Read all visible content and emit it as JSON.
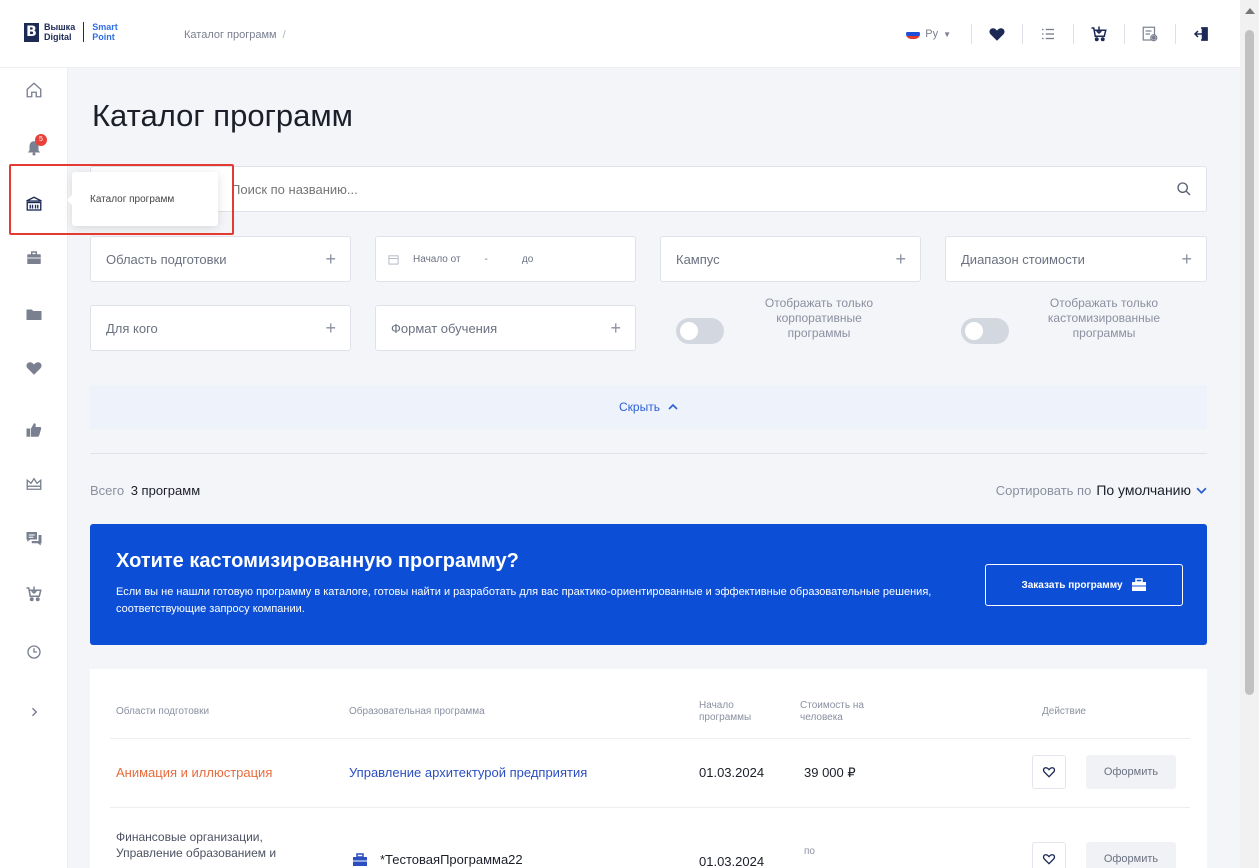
{
  "header": {
    "logo_line1a": "Вышка",
    "logo_line1b": "Digital",
    "logo_line2a": "Smart",
    "logo_line2b": "Point",
    "breadcrumb": "Каталог программ",
    "breadcrumb_sep": "/",
    "language": "Ру",
    "icons": [
      "heart-icon",
      "list-icon",
      "cart-icon",
      "certificate-icon",
      "logout-icon"
    ]
  },
  "sidebar": {
    "items": [
      "home-icon",
      "bell-icon",
      "catalog-icon",
      "briefcase-icon",
      "folder-icon",
      "heart-icon",
      "thumbs-up-icon",
      "crown-icon",
      "chat-icon",
      "cart-icon",
      "clock-icon",
      "expand-icon"
    ],
    "notification_count": "5",
    "tooltip": "Каталог программ"
  },
  "page": {
    "title": "Каталог программ",
    "search_placeholder": "Поиск по названию..."
  },
  "filters": {
    "area": "Область подготовки",
    "start_from": "Начало от",
    "start_dash": "-",
    "start_to": "до",
    "campus": "Кампус",
    "price_range": "Диапазон стоимости",
    "audience": "Для кого",
    "format": "Формат обучения",
    "toggle_corporate": "Отображать только корпоративные программы",
    "toggle_custom": "Отображать только кастомизированные программы",
    "hide_label": "Скрыть"
  },
  "summary": {
    "total_prefix": "Всего",
    "total_value": "3 программ",
    "sort_prefix": "Сортировать по",
    "sort_value": "По умолчанию"
  },
  "banner": {
    "title": "Хотите кастомизированную программу?",
    "text": "Если вы не нашли готовую программу в каталоге, готовы найти и разработать для вас практико-ориентированные и эффективные образовательные решения, соответствующие запросу компании.",
    "button": "Заказать программу",
    "color": "#0c4fd6"
  },
  "table": {
    "headers": {
      "area": "Области подготовки",
      "program": "Образовательная программа",
      "start": "Начало программы",
      "price": "Стоимость на человека",
      "action": "Действие"
    },
    "rows": [
      {
        "area": "Анимация и иллюстрация",
        "program": "Управление архитектурой предприятия",
        "start": "01.03.2024",
        "price": "39 000 ₽",
        "action": "Оформить"
      },
      {
        "area": "Финансовые организации, Управление образованием и",
        "program": "*ТестоваяПрограмма22",
        "start": "01.03.2024",
        "price": "по",
        "action": "Оформить"
      }
    ]
  },
  "colors": {
    "accent": "#2b5fd6",
    "area_link": "#e86b3c",
    "highlight": "#e33a32"
  }
}
